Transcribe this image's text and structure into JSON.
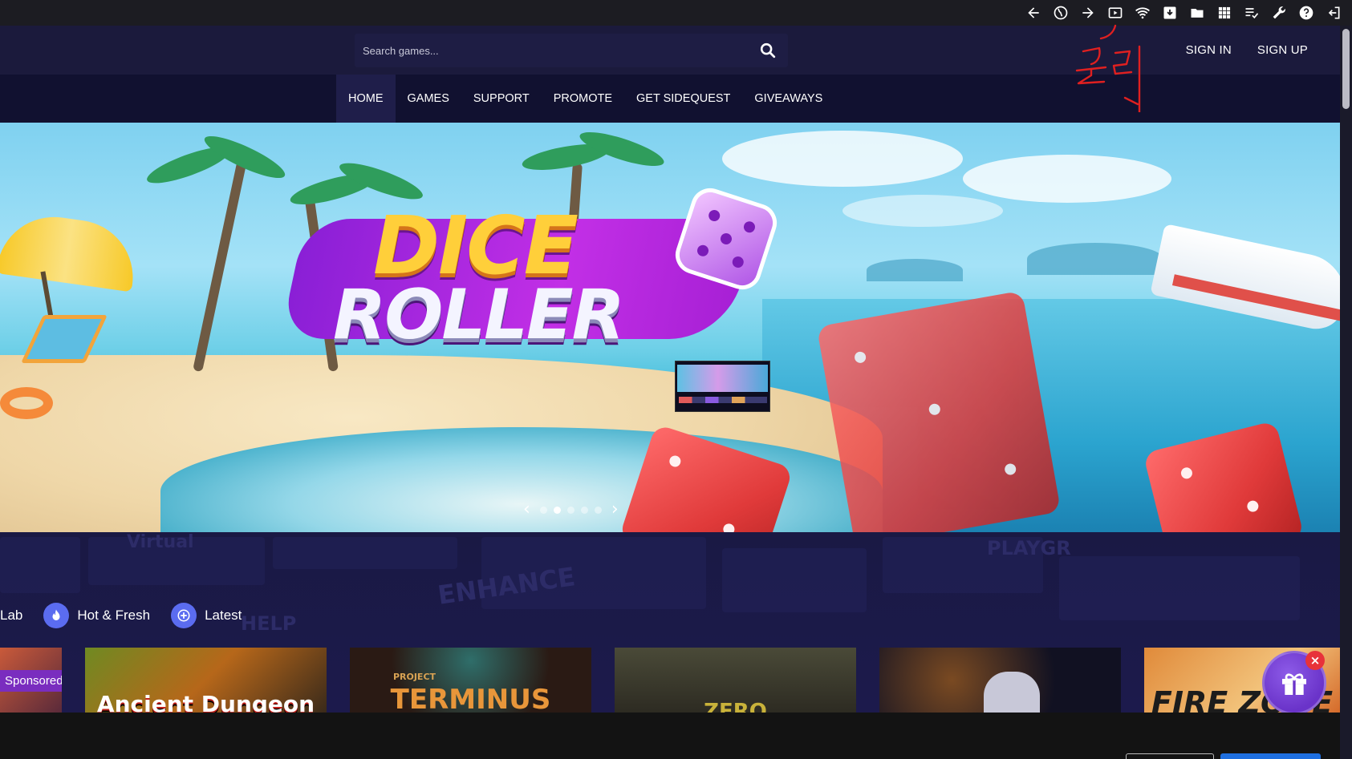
{
  "browser_bar": {
    "icons": [
      "back-arrow-icon",
      "globe-icon",
      "forward-arrow-icon",
      "screen-record-icon",
      "wifi-icon",
      "download-icon",
      "folder-icon",
      "apps-grid-icon",
      "playlist-check-icon",
      "wrench-icon",
      "help-icon",
      "exit-icon"
    ]
  },
  "header": {
    "search_placeholder": "Search games...",
    "sign_in": "SIGN IN",
    "sign_up": "SIGN UP"
  },
  "nav": {
    "items": [
      "HOME",
      "GAMES",
      "SUPPORT",
      "PROMOTE",
      "GET SIDEQUEST",
      "GIVEAWAYS"
    ],
    "active_index": 0
  },
  "annotation": {
    "text": "클릭",
    "color": "#e02020"
  },
  "hero": {
    "logo_line1": "DICE",
    "logo_line2": "ROLLER",
    "slide_count": 5,
    "active_slide": 1
  },
  "categories": {
    "partial_label": "Lab",
    "items": [
      {
        "label": "Hot & Fresh",
        "icon": "flame-icon"
      },
      {
        "label": "Latest",
        "icon": "plus-circle-icon"
      }
    ]
  },
  "background_words": [
    "Virtual",
    "ENHANCE",
    "HELP",
    "PLAYGR"
  ],
  "cards": [
    {
      "title": "",
      "badge": "Sponsored"
    },
    {
      "title": "Ancient Dungeon",
      "badge": ""
    },
    {
      "title": "TERMINUS",
      "subtitle": "PROJECT",
      "badge": ""
    },
    {
      "title": "ZERO",
      "badge": ""
    },
    {
      "title": "",
      "badge": ""
    },
    {
      "title": "FIRE ZONE",
      "badge": ""
    }
  ],
  "colors": {
    "header_bg": "#1b1a3c",
    "nav_bg": "#111130",
    "accent": "#5b6cf0",
    "sponsored": "#7a2dbf"
  }
}
